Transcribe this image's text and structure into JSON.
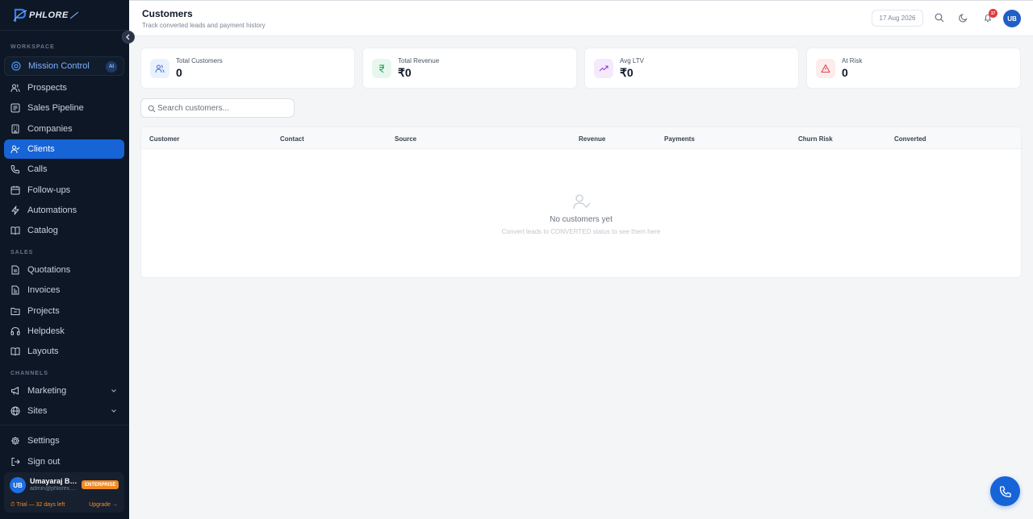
{
  "brand": {
    "name": "PHLORE",
    "accent": "#1664d6"
  },
  "sidebar": {
    "sections": {
      "workspace": "WORKSPACE",
      "sales": "SALES",
      "channels": "CHANNELS"
    },
    "items": [
      {
        "label": "Mission Control",
        "icon": "target-icon",
        "badge": "AI"
      },
      {
        "label": "Prospects",
        "icon": "users-icon"
      },
      {
        "label": "Sales Pipeline",
        "icon": "pipeline-icon"
      },
      {
        "label": "Companies",
        "icon": "building-icon"
      },
      {
        "label": "Clients",
        "icon": "user-check-icon",
        "active": true
      },
      {
        "label": "Calls",
        "icon": "phone-icon"
      },
      {
        "label": "Follow-ups",
        "icon": "calendar-icon"
      },
      {
        "label": "Automations",
        "icon": "bolt-icon"
      },
      {
        "label": "Catalog",
        "icon": "book-icon"
      },
      {
        "label": "Quotations",
        "icon": "document-icon"
      },
      {
        "label": "Invoices",
        "icon": "invoice-icon"
      },
      {
        "label": "Projects",
        "icon": "folder-icon"
      },
      {
        "label": "Helpdesk",
        "icon": "headset-icon"
      },
      {
        "label": "Layouts",
        "icon": "layout-icon"
      },
      {
        "label": "Marketing",
        "icon": "megaphone-icon"
      },
      {
        "label": "Sites",
        "icon": "globe-icon"
      },
      {
        "label": "Settings",
        "icon": "gear-icon"
      },
      {
        "label": "Sign out",
        "icon": "sign-out-icon"
      }
    ],
    "user": {
      "initials": "UB",
      "name": "Umayaraj Bal...",
      "email": "admin@phlorex....",
      "plan": "ENTERPRISE",
      "trial": "⏱ Trial — 32 days left",
      "upgrade": "Upgrade →"
    }
  },
  "header": {
    "title": "Customers",
    "subtitle": "Track converted leads and payment history",
    "date": "17 Aug 2026",
    "notifications": "17",
    "avatar": "UB"
  },
  "stats": [
    {
      "label": "Total Customers",
      "value": "0",
      "icon": "users-icon",
      "color": "#3b6fd8",
      "bg": "#eaf1fd"
    },
    {
      "label": "Total Revenue",
      "value": "₹0",
      "icon": "rupee-icon",
      "color": "#1f9d55",
      "bg": "#e7f7ee"
    },
    {
      "label": "Avg LTV",
      "value": "₹0",
      "icon": "trending-up-icon",
      "color": "#a23bd6",
      "bg": "#f4eafc"
    },
    {
      "label": "At Risk",
      "value": "0",
      "icon": "alert-triangle-icon",
      "color": "#e04848",
      "bg": "#fdecec"
    }
  ],
  "search": {
    "placeholder": "Search customers...",
    "value": ""
  },
  "table": {
    "columns": [
      "Customer",
      "Contact",
      "Source",
      "Revenue",
      "Payments",
      "Churn Risk",
      "Converted"
    ],
    "rows": [],
    "empty_title": "No customers yet",
    "empty_subtitle": "Convert leads to CONVERTED status to see them here"
  }
}
